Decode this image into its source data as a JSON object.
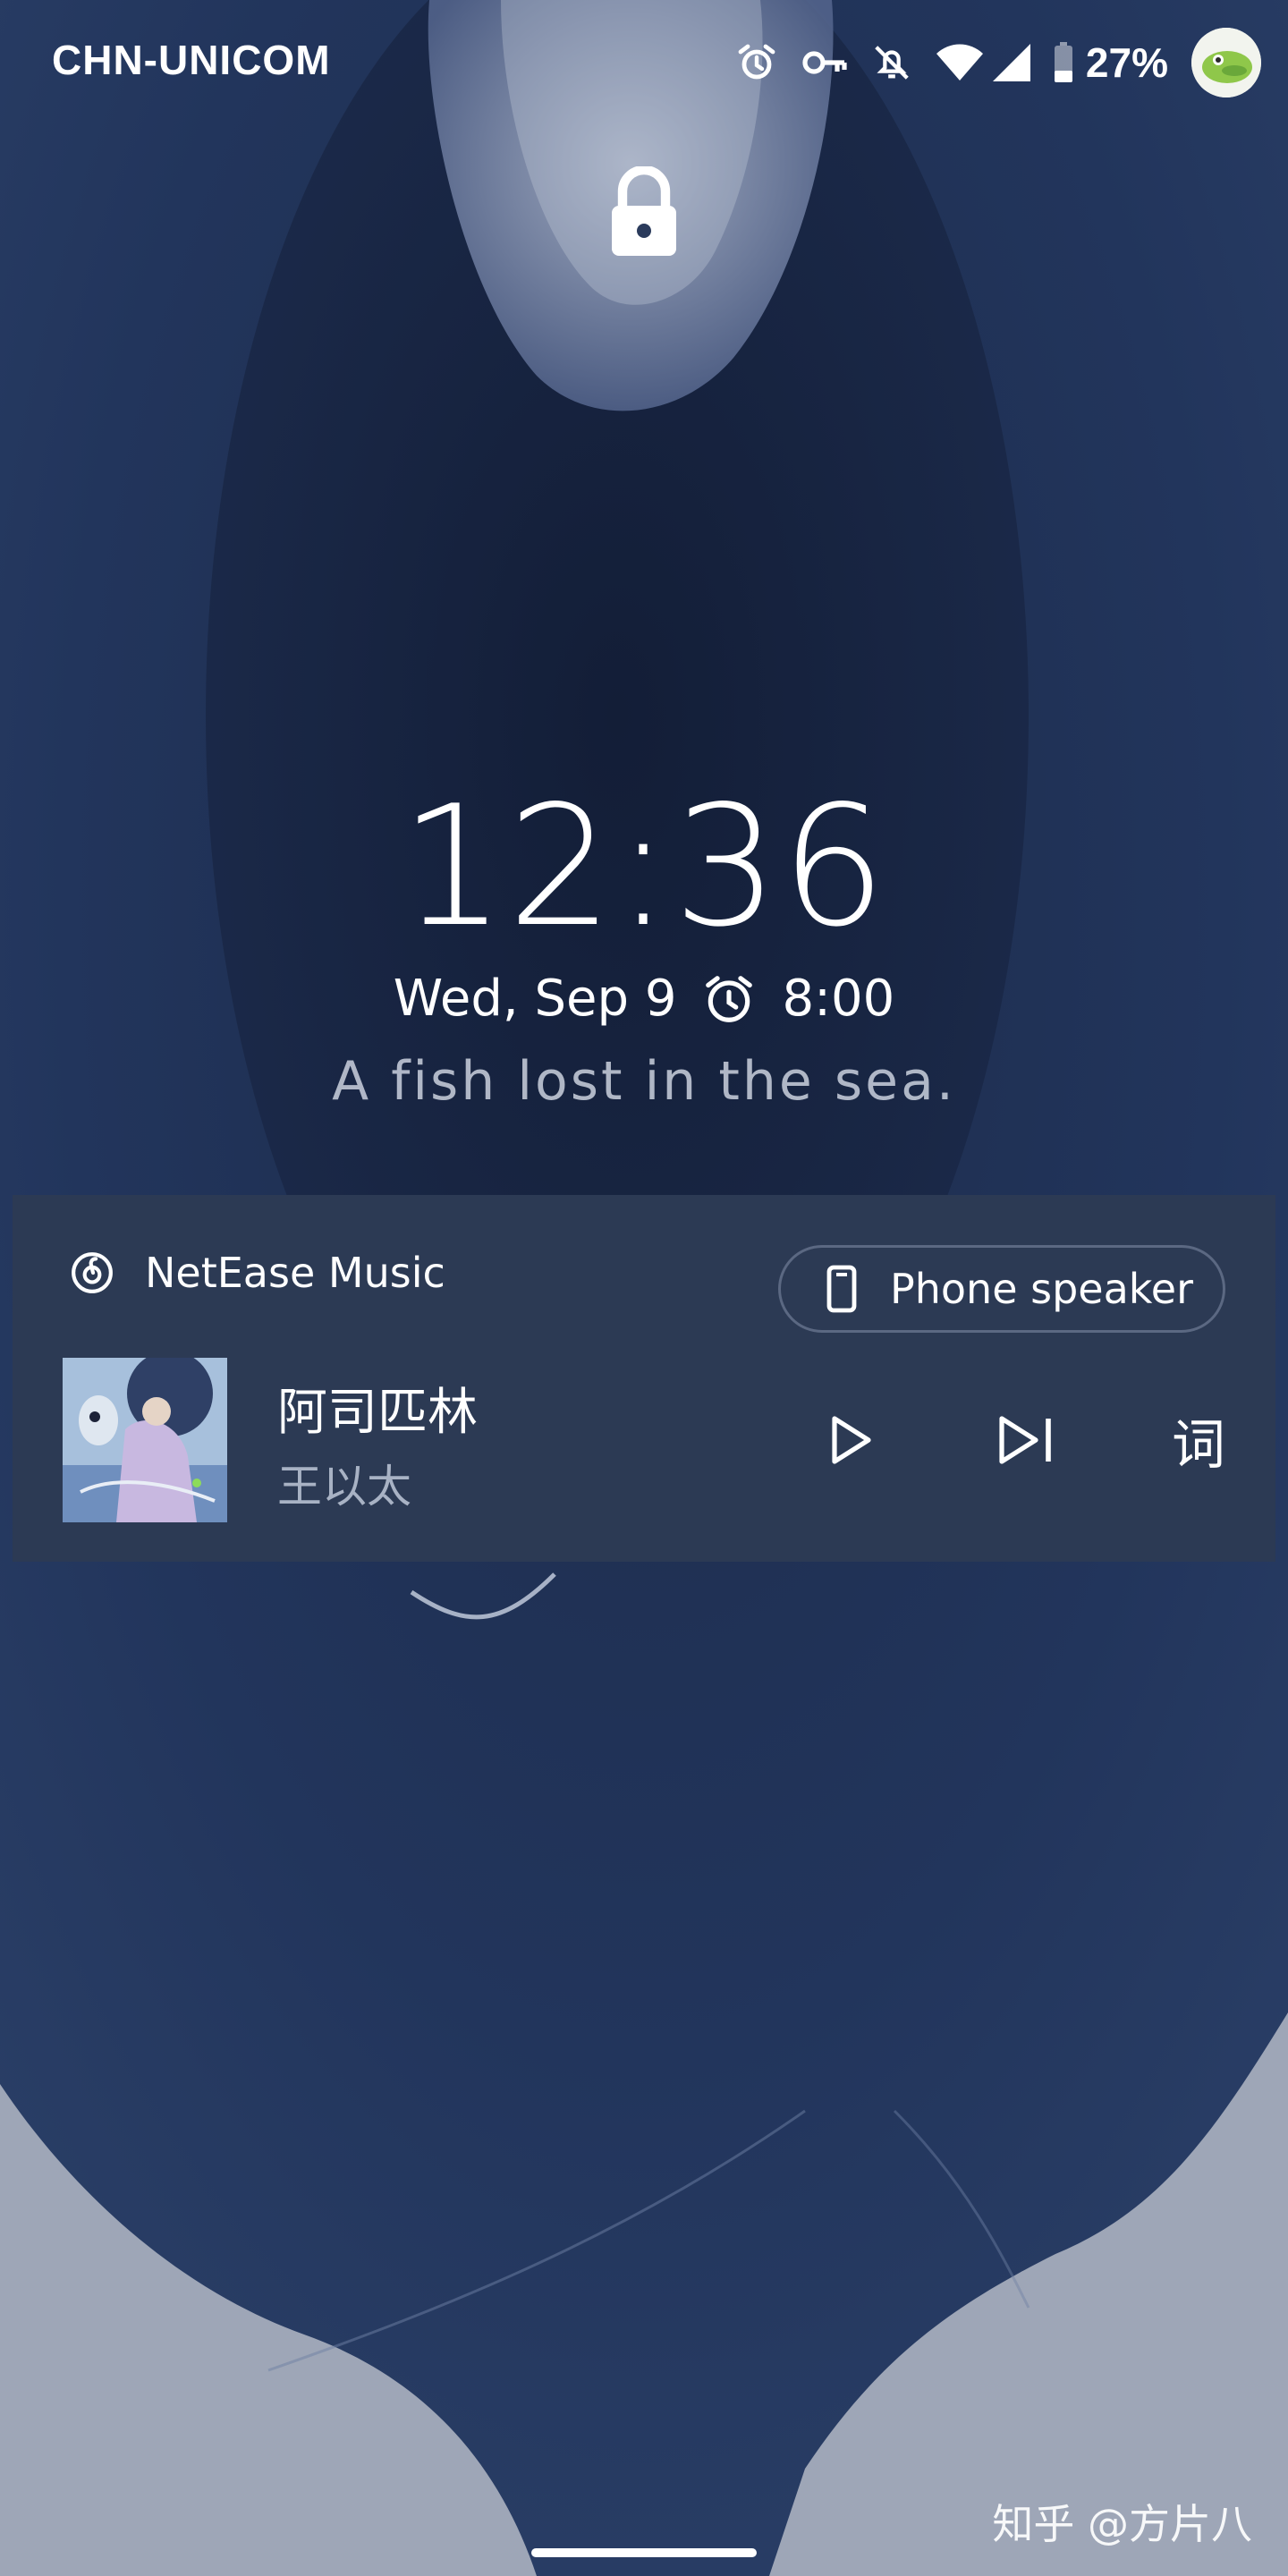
{
  "status_bar": {
    "carrier": "CHN-UNICOM",
    "battery_percent": "27%",
    "icons": [
      "alarm-icon",
      "vpn-key-icon",
      "notifications-off-icon",
      "wifi-icon",
      "cellular-signal-icon",
      "battery-icon"
    ]
  },
  "lockscreen": {
    "time": "12:36",
    "date": "Wed, Sep 9",
    "next_alarm": "8:00",
    "owner_info": "A fish lost in the sea."
  },
  "media": {
    "app_name": "NetEase Music",
    "output_device": "Phone speaker",
    "track_title": "阿司匹林",
    "track_artist": "王以太",
    "lyrics_label": "词",
    "accent_color": "#2c3a54"
  },
  "watermark": "知乎 @方片八"
}
